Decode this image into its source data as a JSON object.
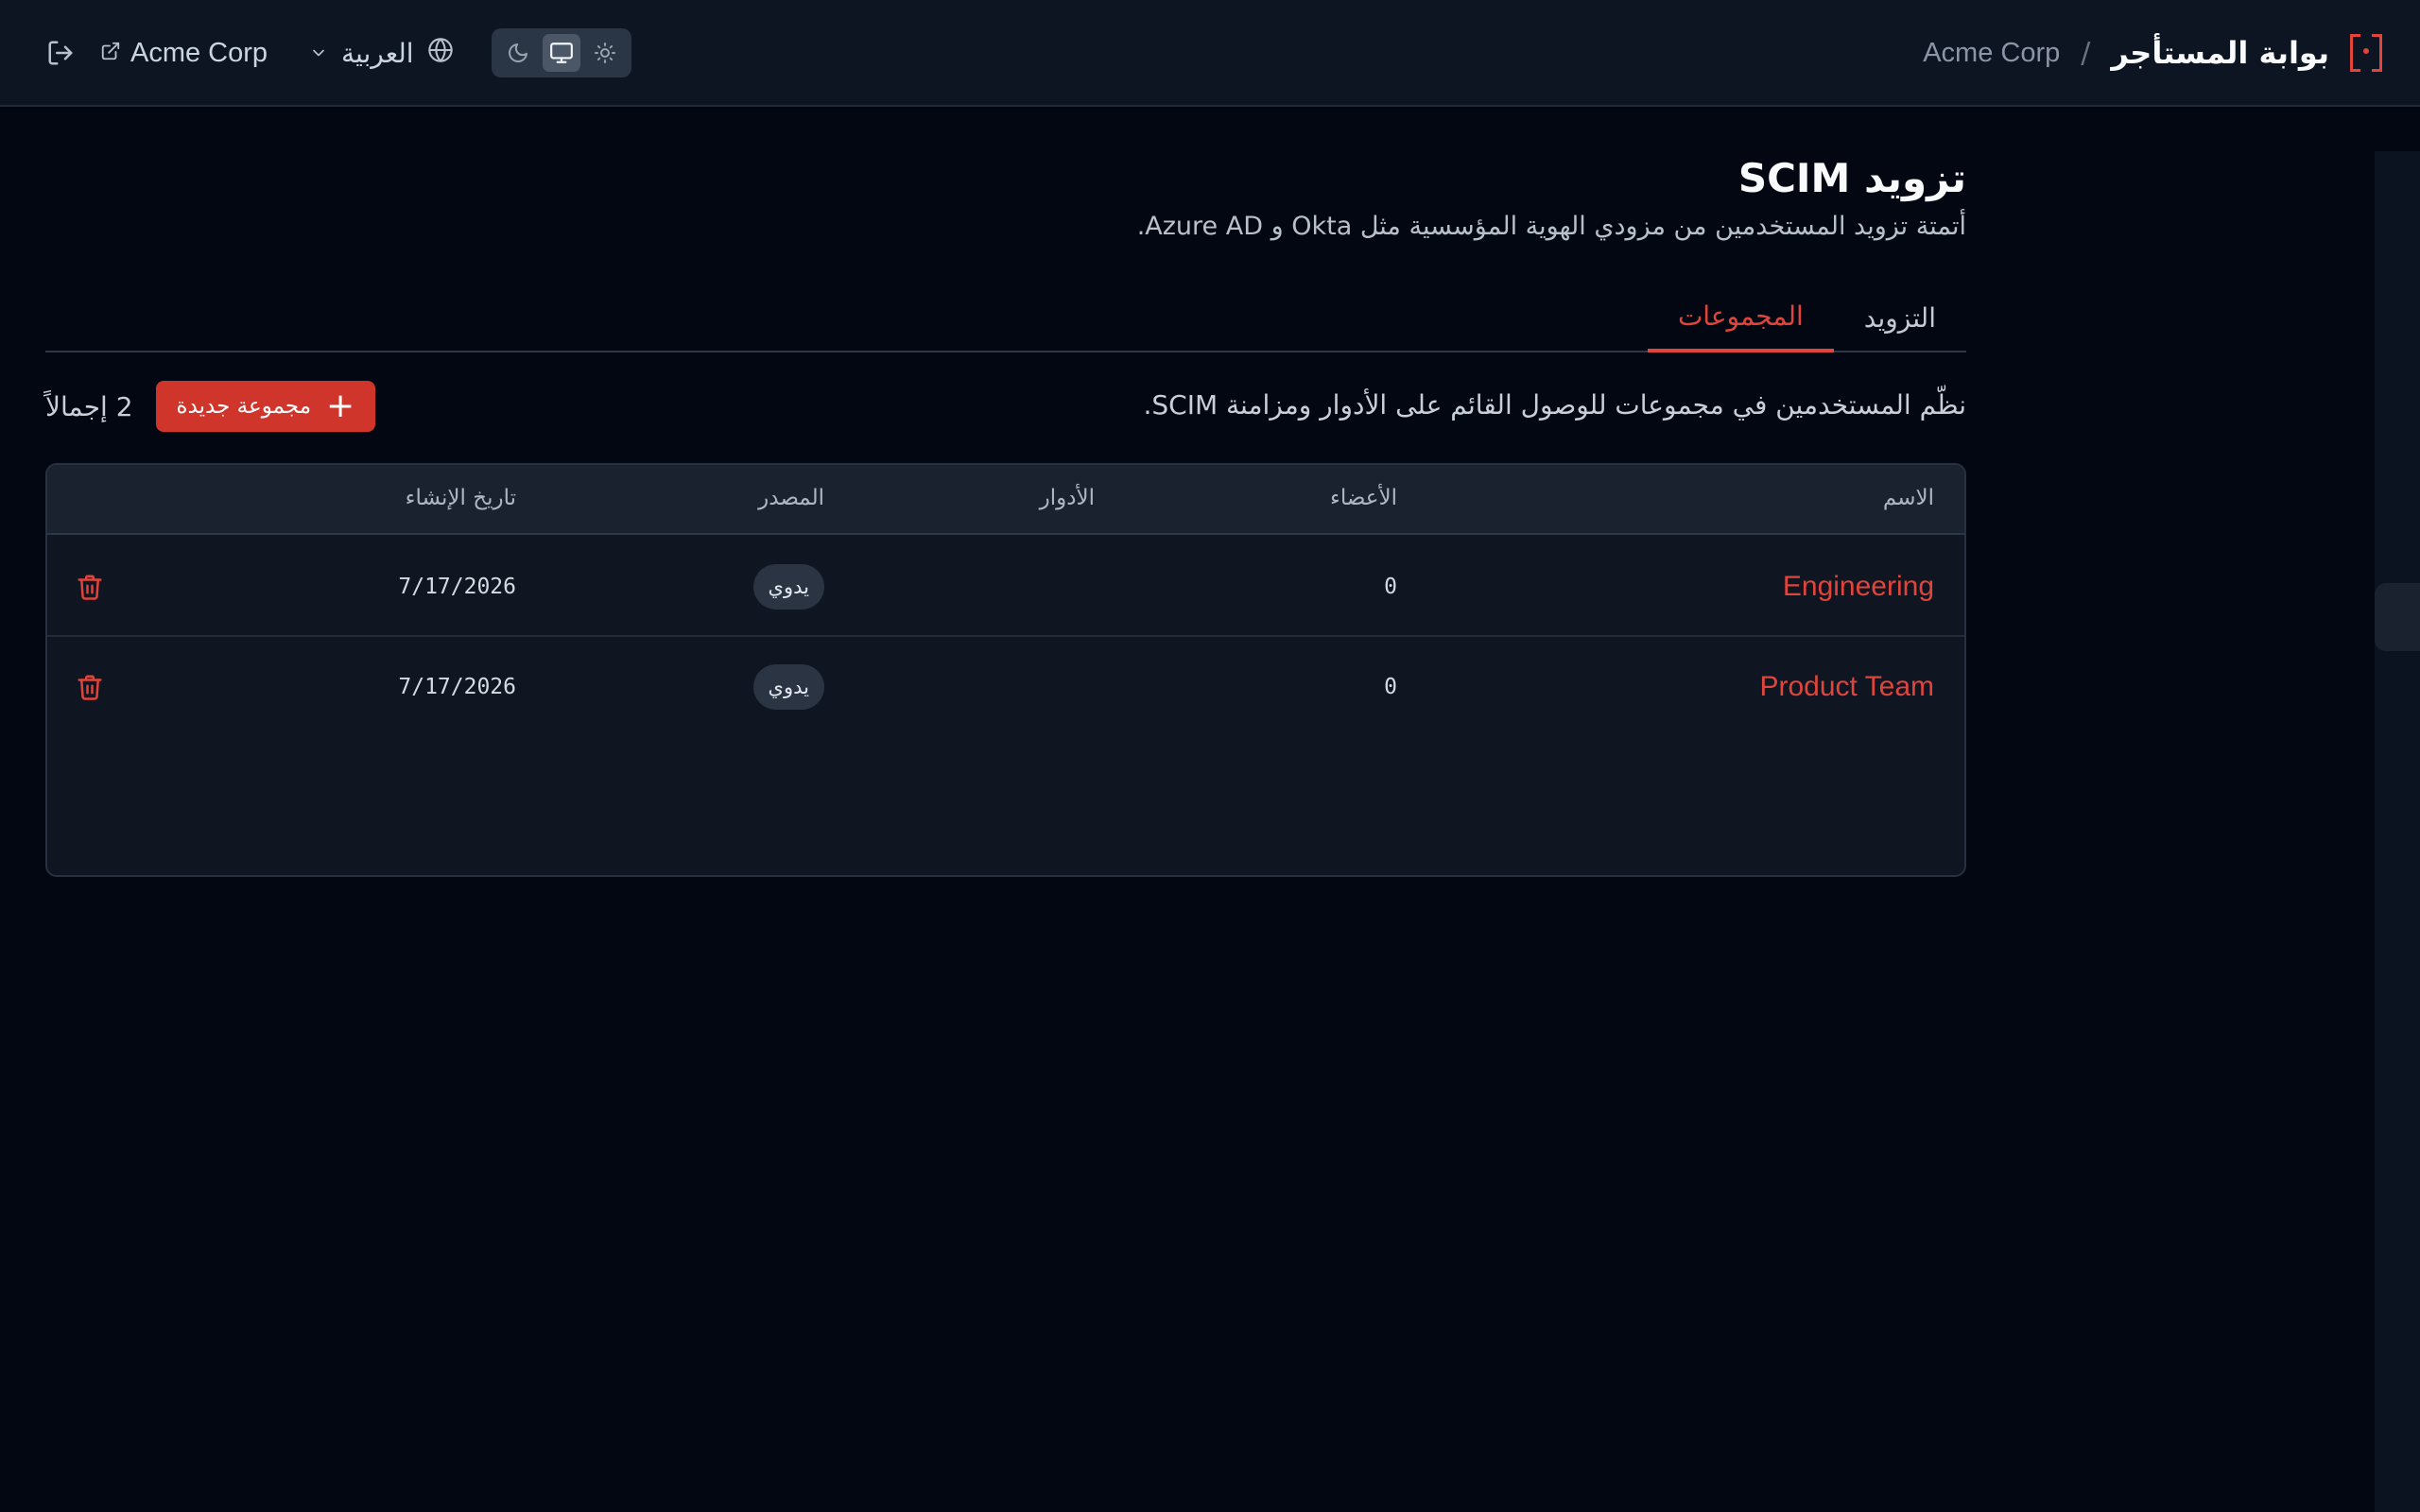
{
  "header": {
    "title": "بوابة المستأجر",
    "separator": "/",
    "tenant": "Acme Corp",
    "tenant_link": "Acme Corp",
    "language": "العربية",
    "theme_options": [
      "light",
      "system",
      "dark"
    ],
    "theme_selected": "system",
    "icons": {
      "logo": "bracket-logo-icon",
      "logout": "logout-icon",
      "external": "external-link-icon",
      "chevron": "chevron-down-icon",
      "globe": "globe-icon",
      "sun": "sun-icon",
      "monitor": "monitor-icon",
      "moon": "moon-icon"
    }
  },
  "page": {
    "title": "تزويد SCIM",
    "subtitle": "أتمتة تزويد المستخدمين من مزودي الهوية المؤسسية مثل Okta و Azure AD."
  },
  "tabs": [
    {
      "label": "التزويد",
      "active": false
    },
    {
      "label": "المجموعات",
      "active": true
    }
  ],
  "toolbar": {
    "description": "نظّم المستخدمين في مجموعات للوصول القائم على الأدوار ومزامنة SCIM.",
    "total": "2 إجمالاً",
    "new_group": "مجموعة جديدة"
  },
  "table": {
    "columns": {
      "name": "الاسم",
      "members": "الأعضاء",
      "roles": "الأدوار",
      "source": "المصدر",
      "created": "تاريخ الإنشاء"
    },
    "rows": [
      {
        "name": "Engineering",
        "members": "0",
        "roles": "",
        "source": "يدوي",
        "created": "7/17/2026"
      },
      {
        "name": "Product Team",
        "members": "0",
        "roles": "",
        "source": "يدوي",
        "created": "7/17/2026"
      }
    ]
  },
  "colors": {
    "accent": "#e0443a",
    "button": "#d0352b",
    "background": "#030711",
    "header": "#0d1523"
  }
}
